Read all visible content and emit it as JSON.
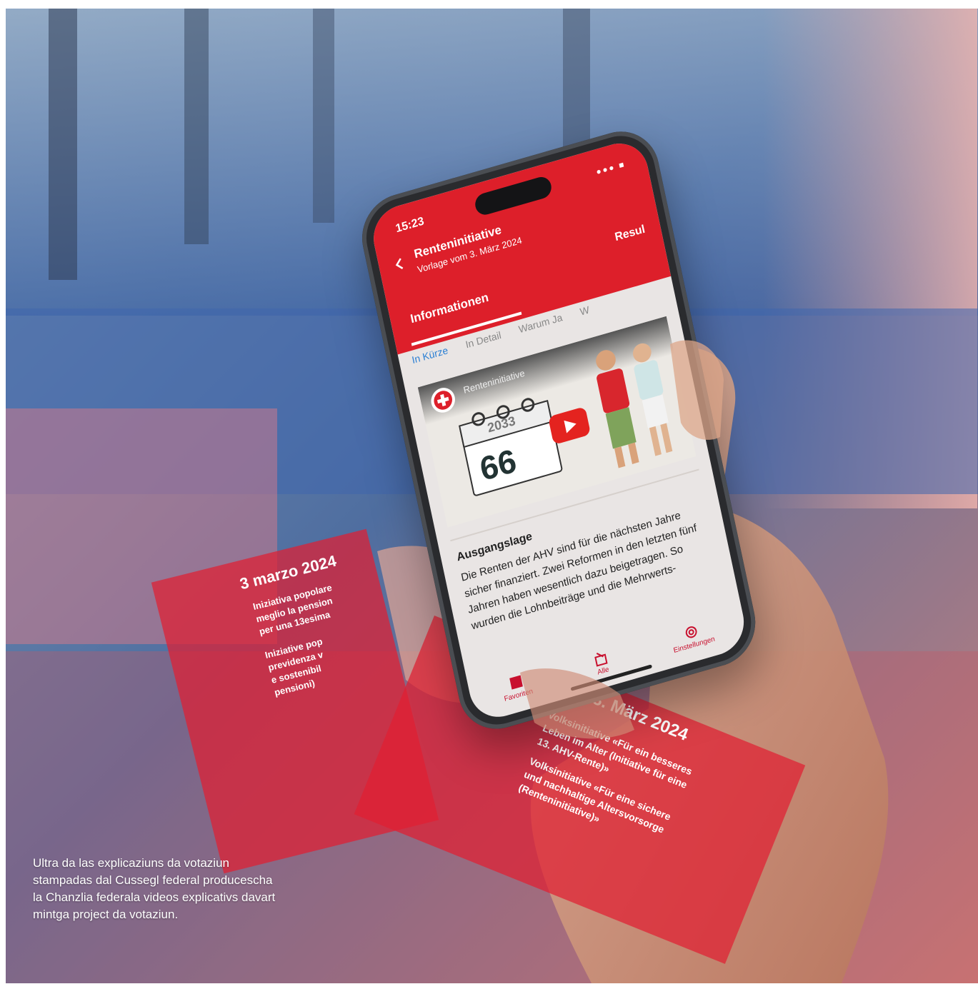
{
  "caption": "Ultra da las explicaziuns da votaziun stampadas dal Cussegl federal producescha la Chanzlia federala videos explicativs davart mintga project da votaziun.",
  "phone": {
    "time": "15:23",
    "title": "Renteninitiative",
    "subtitle": "Vorlage vom 3. März 2024",
    "tabs": [
      "Informationen",
      "Resul"
    ],
    "subtabs": [
      "In Kürze",
      "In Detail",
      "Warum Ja",
      "W"
    ],
    "video": {
      "title": "Renteninitiative",
      "calendar_year": "2033",
      "calendar_day": "66"
    },
    "section_heading": "Ausgangslage",
    "section_text": "Die Renten der AHV sind für die nächsten Jahre sicher finanziert. Zwei Reformen in den letzten fünf Jahren haben wesentlich dazu beigetragen. So wurden die Lohnbeiträge und die Mehrwerts-",
    "nav": [
      "Favoriten",
      "Alle",
      "Einstellungen"
    ]
  },
  "booklets": [
    {
      "date": "3 marzo 2024",
      "lines": [
        "Iniziativa popolare",
        "meglio la pension",
        "per una 13esima",
        "Iniziative pop",
        "previdenza v",
        "e sostenibil",
        "pensioni)"
      ]
    },
    {
      "date": "3. März 2024",
      "lines": [
        "Volksinitiative «Für ein besseres",
        "Leben im Alter (Initiative für eine",
        "13. AHV-Rente)»",
        "Volksinitiative «Für eine sichere",
        "und nachhaltige Altersvorsorge",
        "(Renteninitiative)»"
      ]
    }
  ],
  "colors": {
    "swiss_red": "#dd1f2a",
    "link_blue": "#2a7fd4"
  }
}
